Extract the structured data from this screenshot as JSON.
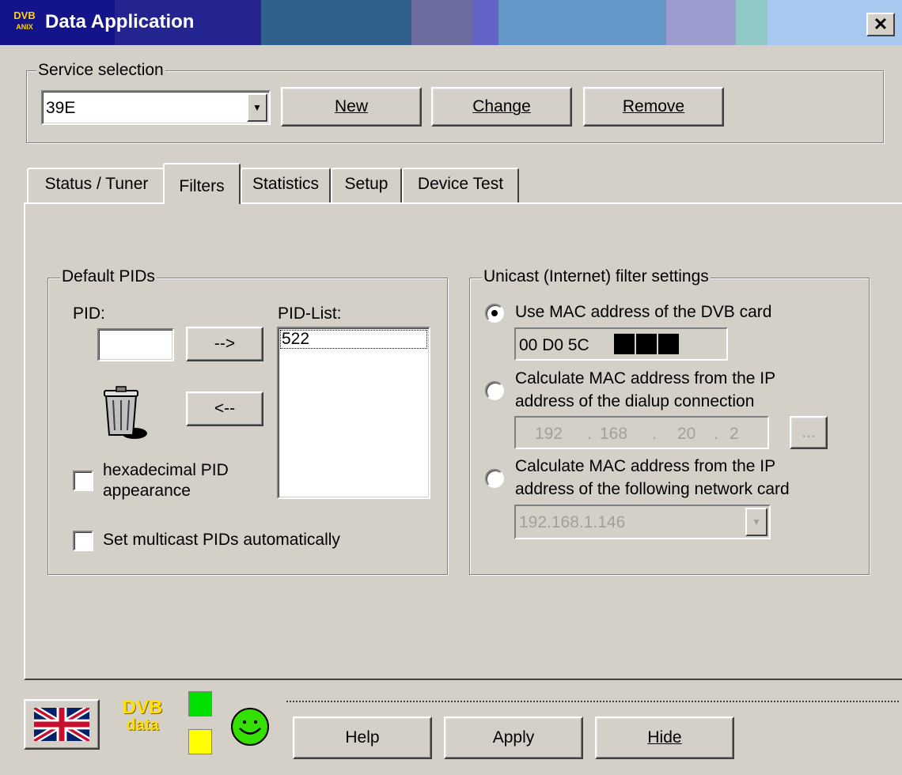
{
  "window": {
    "title": "Data Application",
    "icon": "dvb-mini-logo-icon",
    "close_label": "✕"
  },
  "service": {
    "group_label": "Service selection",
    "selected": "39E",
    "buttons": {
      "new": "New",
      "change": "Change",
      "remove": "Remove"
    }
  },
  "tabs": [
    "Status / Tuner",
    "Filters",
    "Statistics",
    "Setup",
    "Device Test"
  ],
  "active_tab": "Filters",
  "default_pids": {
    "group_label": "Default PIDs",
    "pid_label": "PID:",
    "pid_value": "",
    "list_label": "PID-List:",
    "list_items": [
      "522"
    ],
    "add_label": "-->",
    "remove_label": "<--",
    "hex_checkbox": "hexadecimal PID appearance",
    "hex_checked": false,
    "multicast_checkbox": "Set multicast PIDs automatically",
    "multicast_checked": false
  },
  "unicast": {
    "group_label": "Unicast (Internet) filter settings",
    "option1": "Use MAC address of the DVB card",
    "mac_visible": "00 D0 5C",
    "option2_line1": "Calculate MAC address from the IP",
    "option2_line2": "address of the dialup connection",
    "ip": [
      "192",
      "168",
      "20",
      "2"
    ],
    "ip_button": "...",
    "option3_line1": "Calculate MAC address from the IP",
    "option3_line2": "address of the following network card",
    "network_card": "192.168.1.146",
    "selected_option": 1
  },
  "footer": {
    "flag_icon": "uk-flag-icon",
    "logo_line1": "DVB",
    "logo_line2": "data",
    "indicator_colors": [
      "#00e000",
      "#ffff00"
    ],
    "smiley_icon": "green-smiley-icon",
    "buttons": {
      "help": "Help",
      "apply": "Apply",
      "hide": "Hide"
    }
  }
}
